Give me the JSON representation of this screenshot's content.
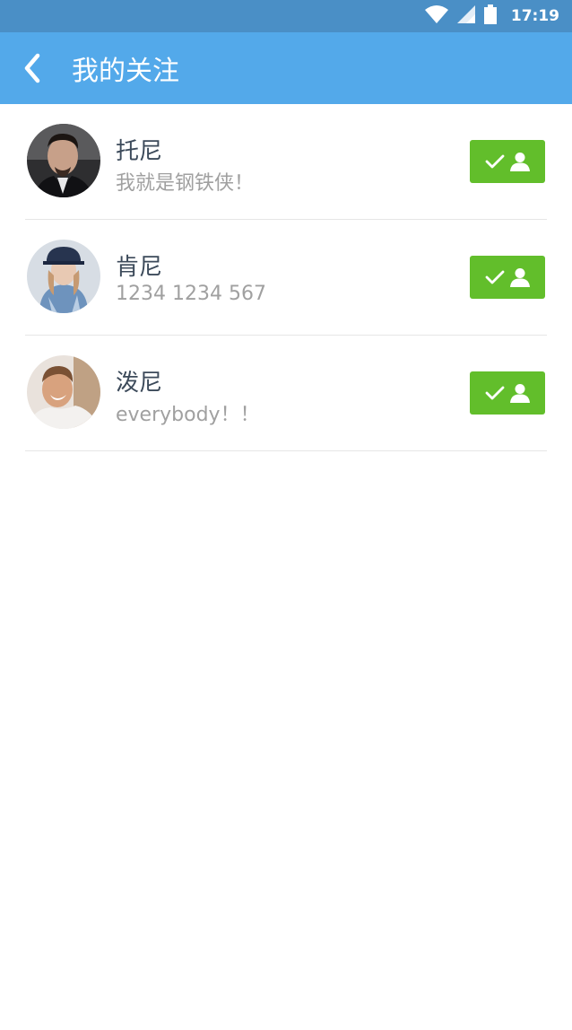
{
  "status_bar": {
    "time": "17:19",
    "icons": [
      "wifi-icon",
      "cell-signal-icon",
      "battery-icon"
    ]
  },
  "header": {
    "title": "我的关注",
    "back_icon": "chevron-left-icon",
    "background": "#53a9ea"
  },
  "following": [
    {
      "name": "托尼",
      "signature": "我就是钢铁侠！",
      "avatar": "avatar-tony",
      "follow_state": "followed"
    },
    {
      "name": "肯尼",
      "signature": "1234 1234 567",
      "avatar": "avatar-kenny",
      "follow_state": "followed"
    },
    {
      "name": "泼尼",
      "signature": "everybody！！",
      "avatar": "avatar-pony",
      "follow_state": "followed"
    }
  ],
  "colors": {
    "status_bar": "#4a8fc6",
    "follow_button": "#62be2b",
    "name_text": "#3c4a5a",
    "signature_text": "#a0a0a0"
  }
}
